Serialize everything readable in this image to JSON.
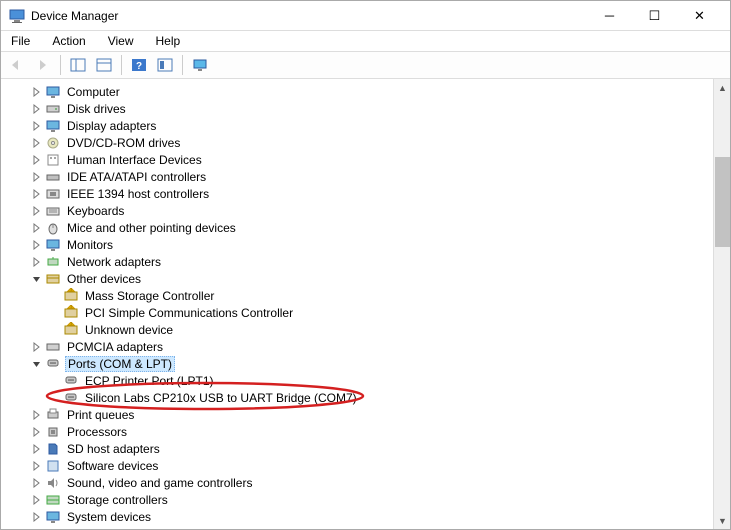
{
  "window": {
    "title": "Device Manager"
  },
  "menu": {
    "file": "File",
    "action": "Action",
    "view": "View",
    "help": "Help"
  },
  "tree": {
    "items": [
      {
        "label": "Computer",
        "icon": "monitor",
        "indent": 1,
        "exp": ">"
      },
      {
        "label": "Disk drives",
        "icon": "drive",
        "indent": 1,
        "exp": ">"
      },
      {
        "label": "Display adapters",
        "icon": "monitor",
        "indent": 1,
        "exp": ">"
      },
      {
        "label": "DVD/CD-ROM drives",
        "icon": "disc",
        "indent": 1,
        "exp": ">"
      },
      {
        "label": "Human Interface Devices",
        "icon": "hid",
        "indent": 1,
        "exp": ">"
      },
      {
        "label": "IDE ATA/ATAPI controllers",
        "icon": "ide",
        "indent": 1,
        "exp": ">"
      },
      {
        "label": "IEEE 1394 host controllers",
        "icon": "ieee",
        "indent": 1,
        "exp": ">"
      },
      {
        "label": "Keyboards",
        "icon": "kbd",
        "indent": 1,
        "exp": ">"
      },
      {
        "label": "Mice and other pointing devices",
        "icon": "mouse",
        "indent": 1,
        "exp": ">"
      },
      {
        "label": "Monitors",
        "icon": "monitor",
        "indent": 1,
        "exp": ">"
      },
      {
        "label": "Network adapters",
        "icon": "net",
        "indent": 1,
        "exp": ">"
      },
      {
        "label": "Other devices",
        "icon": "other",
        "indent": 1,
        "exp": "v"
      },
      {
        "label": "Mass Storage Controller",
        "icon": "warn",
        "indent": 2,
        "exp": ""
      },
      {
        "label": "PCI Simple Communications Controller",
        "icon": "warn",
        "indent": 2,
        "exp": ""
      },
      {
        "label": "Unknown device",
        "icon": "warn",
        "indent": 2,
        "exp": ""
      },
      {
        "label": "PCMCIA adapters",
        "icon": "pcmcia",
        "indent": 1,
        "exp": ">"
      },
      {
        "label": "Ports (COM & LPT)",
        "icon": "port",
        "indent": 1,
        "exp": "v",
        "selected": true
      },
      {
        "label": "ECP Printer Port (LPT1)",
        "icon": "port",
        "indent": 2,
        "exp": ""
      },
      {
        "label": "Silicon Labs CP210x USB to UART Bridge (COM7)",
        "icon": "port",
        "indent": 2,
        "exp": "",
        "circled": true
      },
      {
        "label": "Print queues",
        "icon": "printer",
        "indent": 1,
        "exp": ">"
      },
      {
        "label": "Processors",
        "icon": "cpu",
        "indent": 1,
        "exp": ">"
      },
      {
        "label": "SD host adapters",
        "icon": "sd",
        "indent": 1,
        "exp": ">"
      },
      {
        "label": "Software devices",
        "icon": "soft",
        "indent": 1,
        "exp": ">"
      },
      {
        "label": "Sound, video and game controllers",
        "icon": "sound",
        "indent": 1,
        "exp": ">"
      },
      {
        "label": "Storage controllers",
        "icon": "storage",
        "indent": 1,
        "exp": ">"
      },
      {
        "label": "System devices",
        "icon": "sys",
        "indent": 1,
        "exp": ">"
      }
    ]
  }
}
